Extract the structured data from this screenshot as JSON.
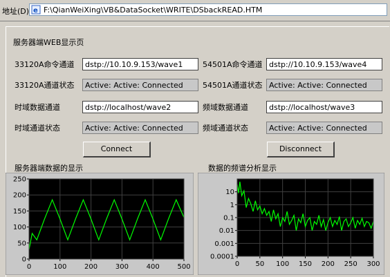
{
  "address": {
    "label": "地址(D)",
    "url": "F:\\QianWeiXing\\VB&DataSocket\\WRITE\\DSbackREAD.HTM"
  },
  "page_title": "服务器端WEB显示页",
  "left": {
    "cmd_label": "33120A命令通道",
    "cmd_value": "dstp://10.10.9.153/wave1",
    "status_label": "33120A通道状态",
    "status_value": "Active: Active: Connected",
    "data_label": "时域数据通道",
    "data_value": "dstp://localhost/wave2",
    "data_status_label": "时域通道状态",
    "data_status_value": "Active: Active: Connected"
  },
  "right": {
    "cmd_label": "54501A命令通道",
    "cmd_value": "dstp://10.10.9.153/wave4",
    "status_label": "54501A通道状态",
    "status_value": "Active: Active: Connected",
    "data_label": "频域数据通道",
    "data_value": "dstp://localhost/wave3",
    "data_status_label": "频域通道状态",
    "data_status_value": "Active: Active: Connected"
  },
  "buttons": {
    "connect": "Connect",
    "disconnect": "Disconnect"
  },
  "colors": {
    "plot_bg": "#000000",
    "trace": "#00ff00",
    "grid": "#404040"
  },
  "chart_data": [
    {
      "type": "line",
      "title": "服务器端数据的显示",
      "xlim": [
        0,
        500
      ],
      "ylim": [
        0,
        250
      ],
      "x_ticks": [
        "0",
        "100",
        "200",
        "300",
        "400",
        "500"
      ],
      "y_ticks": [
        "0",
        "50",
        "100",
        "150",
        "200",
        "250"
      ],
      "grid": true,
      "series": [
        {
          "x": [
            0,
            10,
            25,
            50,
            75,
            100,
            125,
            150,
            175,
            200,
            225,
            250,
            275,
            300,
            325,
            350,
            375,
            400,
            425,
            450,
            475,
            500
          ],
          "values": [
            30,
            80,
            60,
            125,
            185,
            125,
            60,
            125,
            185,
            125,
            60,
            125,
            185,
            125,
            60,
            125,
            185,
            125,
            60,
            125,
            185,
            130
          ]
        }
      ]
    },
    {
      "type": "line",
      "title": "数据的频谱分析显示",
      "xlim": [
        0,
        300
      ],
      "ylim": [
        0.0001,
        100
      ],
      "y_scale": "log",
      "x_ticks": [
        "0",
        "50",
        "100",
        "150",
        "200",
        "250",
        "300"
      ],
      "y_ticks": [
        "10",
        "1",
        "0.1",
        "0.01",
        "0.001",
        "0.0001"
      ],
      "grid": true,
      "series": [
        {
          "x": [
            0,
            3,
            6,
            10,
            15,
            20,
            25,
            30,
            35,
            40,
            45,
            50,
            55,
            60,
            65,
            70,
            75,
            80,
            85,
            90,
            95,
            100,
            105,
            110,
            115,
            120,
            125,
            130,
            135,
            140,
            145,
            150,
            155,
            160,
            165,
            170,
            175,
            180,
            185,
            190,
            195,
            200,
            205,
            210,
            215,
            220,
            225,
            230,
            235,
            240,
            245,
            250,
            255,
            260,
            265,
            270,
            275,
            280,
            285,
            290,
            295,
            300
          ],
          "values": [
            40,
            8,
            60,
            5,
            12,
            0.6,
            3,
            1.2,
            0.3,
            2,
            0.4,
            0.8,
            0.2,
            0.5,
            0.15,
            0.3,
            0.05,
            0.4,
            0.08,
            0.2,
            0.02,
            0.1,
            0.05,
            0.3,
            0.03,
            0.06,
            0.15,
            0.01,
            0.08,
            0.04,
            0.2,
            0.02,
            0.06,
            0.1,
            0.01,
            0.05,
            0.03,
            0.15,
            0.02,
            0.07,
            0.01,
            0.04,
            0.1,
            0.02,
            0.06,
            0.03,
            0.12,
            0.01,
            0.05,
            0.08,
            0.02,
            0.04,
            0.1,
            0.015,
            0.06,
            0.03,
            0.09,
            0.02,
            0.05,
            0.04,
            0.015,
            0.05
          ]
        }
      ]
    }
  ]
}
